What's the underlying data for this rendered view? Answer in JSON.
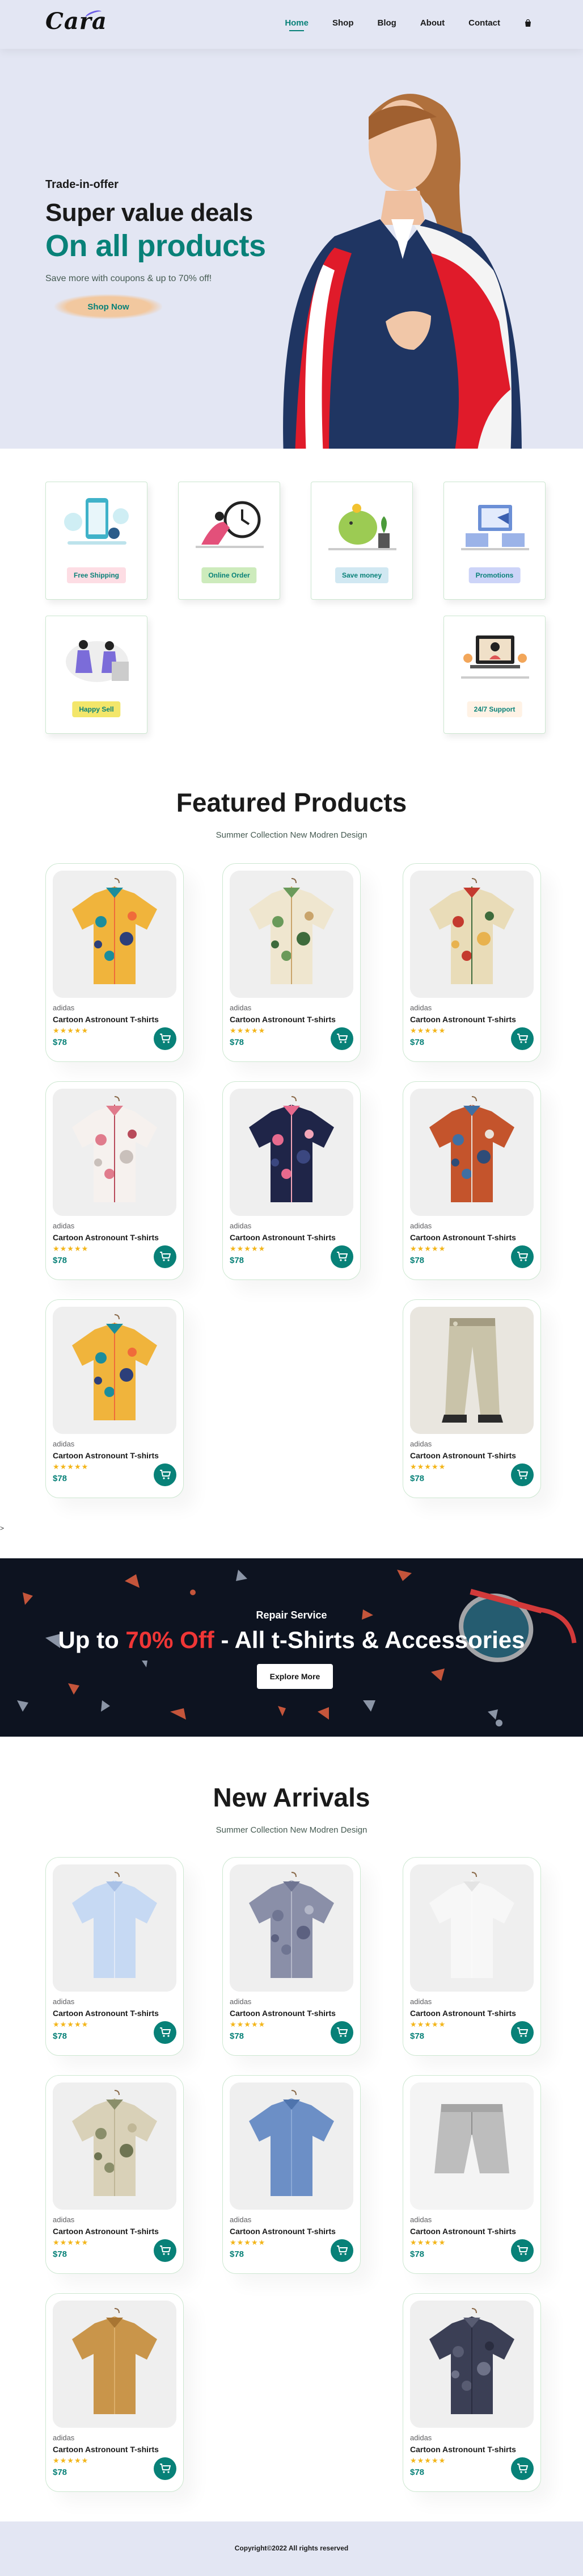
{
  "header": {
    "logo": "Cara",
    "nav": [
      "Home",
      "Shop",
      "Blog",
      "About",
      "Contact"
    ],
    "active_nav": "Home",
    "cart_icon": "shopping-bag-icon"
  },
  "hero": {
    "eyebrow": "Trade-in-offer",
    "title": "Super value deals",
    "highlight": "On all products",
    "text": "Save more with coupons & up to 70% off!",
    "button": "Shop Now"
  },
  "features": [
    {
      "label": "Free Shipping",
      "icon": "shipping-illustration",
      "color": "#fddde4"
    },
    {
      "label": "Online Order",
      "icon": "online-order-illustration",
      "color": "#cdebbc"
    },
    {
      "label": "Save money",
      "icon": "save-money-illustration",
      "color": "#d1e8f2"
    },
    {
      "label": "Promotions",
      "icon": "promotions-illustration",
      "color": "#cdd4f8"
    },
    {
      "label": "Happy Sell",
      "icon": "happy-sell-illustration",
      "color": "#f6dbf6"
    },
    {
      "label": "24/7 Support",
      "icon": "support-illustration",
      "color": "#fff2e5"
    }
  ],
  "featured": {
    "title": "Featured Products",
    "subtitle": "Summer Collection New Modren Design",
    "products": [
      {
        "brand": "adidas",
        "name": "Cartoon Astronount T-shirts",
        "stars": "★★★★★",
        "price": "$78",
        "image": "colorful-patchwork-shirt"
      },
      {
        "brand": "adidas",
        "name": "Cartoon Astronount T-shirts",
        "stars": "★★★★★",
        "price": "$78",
        "image": "leaf-print-shirt"
      },
      {
        "brand": "adidas",
        "name": "Cartoon Astronount T-shirts",
        "stars": "★★★★★",
        "price": "$78",
        "image": "red-floral-shirt"
      },
      {
        "brand": "adidas",
        "name": "Cartoon Astronount T-shirts",
        "stars": "★★★★★",
        "price": "$78",
        "image": "white-floral-shirt"
      },
      {
        "brand": "adidas",
        "name": "Cartoon Astronount T-shirts",
        "stars": "★★★★★",
        "price": "$78",
        "image": "navy-floral-shirt"
      },
      {
        "brand": "adidas",
        "name": "Cartoon Astronount T-shirts",
        "stars": "★★★★★",
        "price": "$78",
        "image": "orange-denim-layered-shirt"
      },
      {
        "brand": "adidas",
        "name": "Cartoon Astronount T-shirts",
        "stars": "★★★★★",
        "price": "$78",
        "image": "colorful-patchwork-shirt"
      },
      {
        "brand": "adidas",
        "name": "Cartoon Astronount T-shirts",
        "stars": "★★★★★",
        "price": "$78",
        "image": "khaki-trousers"
      }
    ]
  },
  "stray_char": ">",
  "banner": {
    "eyebrow": "Repair Service",
    "title_pre": "Up to",
    "title_highlight": "70% Off",
    "title_post": "- All t-Shirts & Accessories",
    "button": "Explore More"
  },
  "arrivals": {
    "title": "New Arrivals",
    "subtitle": "Summer Collection New Modren Design",
    "products": [
      {
        "brand": "adidas",
        "name": "Cartoon Astronount T-shirts",
        "stars": "★★★★★",
        "price": "$78",
        "image": "light-blue-shirt"
      },
      {
        "brand": "adidas",
        "name": "Cartoon Astronount T-shirts",
        "stars": "★★★★★",
        "price": "$78",
        "image": "gray-check-shirt"
      },
      {
        "brand": "adidas",
        "name": "Cartoon Astronount T-shirts",
        "stars": "★★★★★",
        "price": "$78",
        "image": "white-shirt"
      },
      {
        "brand": "adidas",
        "name": "Cartoon Astronount T-shirts",
        "stars": "★★★★★",
        "price": "$78",
        "image": "beige-leaf-shirt"
      },
      {
        "brand": "adidas",
        "name": "Cartoon Astronount T-shirts",
        "stars": "★★★★★",
        "price": "$78",
        "image": "denim-shirt"
      },
      {
        "brand": "adidas",
        "name": "Cartoon Astronount T-shirts",
        "stars": "★★★★★",
        "price": "$78",
        "image": "gray-shorts"
      },
      {
        "brand": "adidas",
        "name": "Cartoon Astronount T-shirts",
        "stars": "★★★★★",
        "price": "$78",
        "image": "tan-jacket"
      },
      {
        "brand": "adidas",
        "name": "Cartoon Astronount T-shirts",
        "stars": "★★★★★",
        "price": "$78",
        "image": "dark-check-shirt"
      }
    ]
  },
  "footer": {
    "copyright": "Copyright©2022 All rights reserved"
  }
}
